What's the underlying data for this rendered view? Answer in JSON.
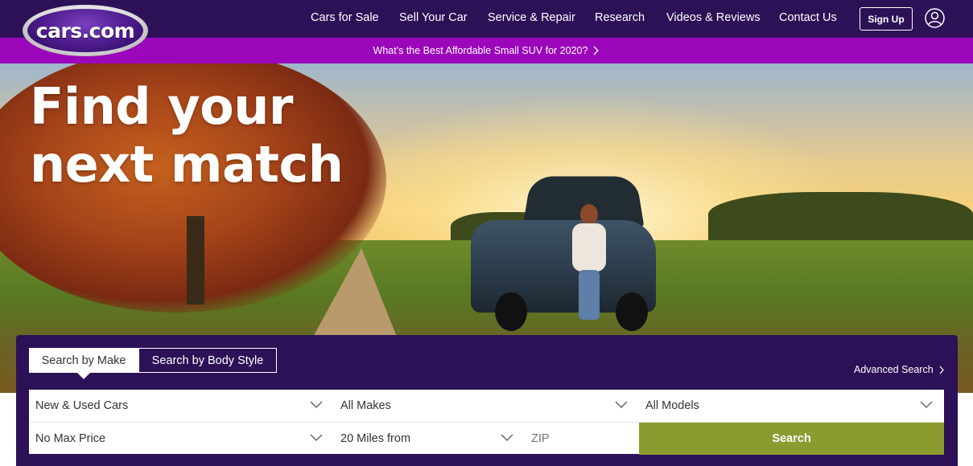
{
  "brand": {
    "logo_text": "cars.com",
    "header_color": "#2c1157",
    "promo_color": "#9b06ba",
    "search_color": "#8c9b2f"
  },
  "nav": {
    "items": [
      {
        "label": "Cars for Sale"
      },
      {
        "label": "Sell Your Car"
      },
      {
        "label": "Service & Repair"
      },
      {
        "label": "Research"
      },
      {
        "label": "Videos & Reviews"
      },
      {
        "label": "Contact Us"
      }
    ],
    "signup_label": "Sign Up",
    "user_icon": "user-icon"
  },
  "promo": {
    "text": "What's the Best Affordable Small SUV for 2020?",
    "icon": "chevron-right-icon"
  },
  "hero": {
    "title_line1": "Find your",
    "title_line2": "next match"
  },
  "search": {
    "tabs": [
      {
        "label": "Search by Make",
        "active": true
      },
      {
        "label": "Search by Body Style",
        "active": false
      }
    ],
    "advanced_label": "Advanced Search",
    "stock_type": "New & Used Cars",
    "make": "All Makes",
    "model": "All Models",
    "max_price": "No Max Price",
    "distance": "20 Miles from",
    "zip_placeholder": "ZIP",
    "search_label": "Search"
  }
}
